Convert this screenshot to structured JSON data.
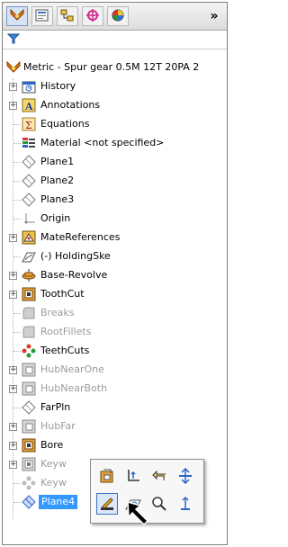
{
  "tabs": [
    {
      "name": "feature-manager-tab",
      "icon": "feature-tree-icon"
    },
    {
      "name": "property-manager-tab",
      "icon": "property-manager-icon"
    },
    {
      "name": "configuration-manager-tab",
      "icon": "configuration-manager-icon"
    },
    {
      "name": "dimxpert-manager-tab",
      "icon": "dimxpert-icon"
    },
    {
      "name": "display-manager-tab",
      "icon": "display-manager-icon"
    }
  ],
  "more_label": "»",
  "tree": {
    "root": "Metric - Spur gear 0.5M 12T 20PA 2",
    "items": [
      {
        "label": "History"
      },
      {
        "label": "Annotations"
      },
      {
        "label": "Equations"
      },
      {
        "label": "Material <not specified>"
      },
      {
        "label": "Plane1"
      },
      {
        "label": "Plane2"
      },
      {
        "label": "Plane3"
      },
      {
        "label": "Origin"
      },
      {
        "label": "MateReferences"
      },
      {
        "label": "(-) HoldingSke"
      },
      {
        "label": "Base-Revolve"
      },
      {
        "label": "ToothCut"
      },
      {
        "label": "Breaks"
      },
      {
        "label": "RootFillets"
      },
      {
        "label": "TeethCuts"
      },
      {
        "label": "HubNearOne"
      },
      {
        "label": "HubNearBoth"
      },
      {
        "label": "FarPln"
      },
      {
        "label": "HubFar"
      },
      {
        "label": "Bore"
      },
      {
        "label": "Keyw"
      },
      {
        "label": "Keyw"
      },
      {
        "label": "Plane4"
      }
    ]
  },
  "context_toolbar": {
    "buttons": [
      {
        "name": "feature-properties-button"
      },
      {
        "name": "normal-to-button"
      },
      {
        "name": "rollback-button"
      },
      {
        "name": "move-entity-button"
      },
      {
        "name": "edit-feature-button"
      },
      {
        "name": "sketch-button"
      },
      {
        "name": "zoom-to-selection-button"
      },
      {
        "name": "suppress-button"
      }
    ]
  }
}
